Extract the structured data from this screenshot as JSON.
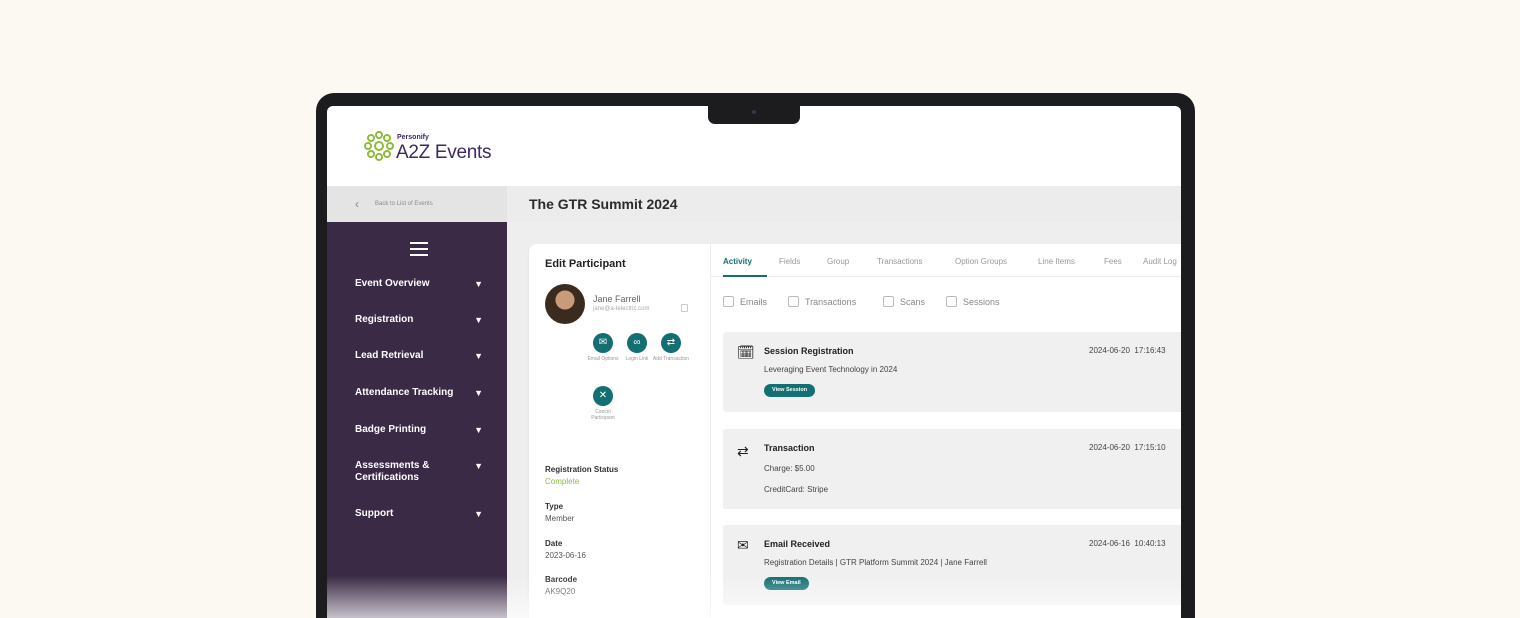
{
  "brand": {
    "small": "Personify",
    "name": "A2Z Events",
    "accent": "#8fba3c",
    "brand_color": "#3d2a63"
  },
  "topbar": {
    "back_label": "Back to List of Events",
    "event_title": "The GTR Summit 2024"
  },
  "sidebar": {
    "items": [
      {
        "label": "Event Overview"
      },
      {
        "label": "Registration"
      },
      {
        "label": "Lead Retrieval"
      },
      {
        "label": "Attendance Tracking"
      },
      {
        "label": "Badge Printing"
      },
      {
        "label": "Assessments & Certifications"
      },
      {
        "label": "Support"
      }
    ]
  },
  "participant": {
    "panel_title": "Edit Participant",
    "name": "Jane Farrell",
    "email": "jane@a-telectric.com",
    "actions": [
      {
        "label": "Email Options",
        "icon": "mail-icon"
      },
      {
        "label": "Login Link",
        "icon": "link-icon"
      },
      {
        "label": "Add Transaction",
        "icon": "exchange-icon"
      },
      {
        "label": "Cancel Participant",
        "icon": "close-icon"
      }
    ],
    "fields": [
      {
        "label": "Registration Status",
        "value": "Complete"
      },
      {
        "label": "Type",
        "value": "Member"
      },
      {
        "label": "Date",
        "value": "2023-06-16"
      },
      {
        "label": "Barcode",
        "value": "AK9Q20"
      }
    ]
  },
  "tabs": [
    "Activity",
    "Fields",
    "Group",
    "Transactions",
    "Option Groups",
    "Line Items",
    "Fees",
    "Audit Log"
  ],
  "filters": [
    "Emails",
    "Transactions",
    "Scans",
    "Sessions"
  ],
  "activity": [
    {
      "icon": "calendar-icon",
      "title": "Session Registration",
      "date": "2024-06-20",
      "time": "17:16:43",
      "lines": [
        "Leveraging Event Technology in 2024"
      ],
      "button": "View Session"
    },
    {
      "icon": "exchange-icon",
      "title": "Transaction",
      "date": "2024-06-20",
      "time": "17:15:10",
      "lines": [
        "Charge: $5.00",
        "CreditCard: Stripe"
      ]
    },
    {
      "icon": "mail-icon",
      "title": "Email Received",
      "date": "2024-06-16",
      "time": "10:40:13",
      "lines": [
        "Registration Details  |  GTR Platform Summit 2024  |  Jane Farrell"
      ],
      "button": "View Email"
    }
  ],
  "colors": {
    "teal": "#146f73",
    "sidebar": "#3a2a45",
    "status_ok": "#8fba3c"
  }
}
